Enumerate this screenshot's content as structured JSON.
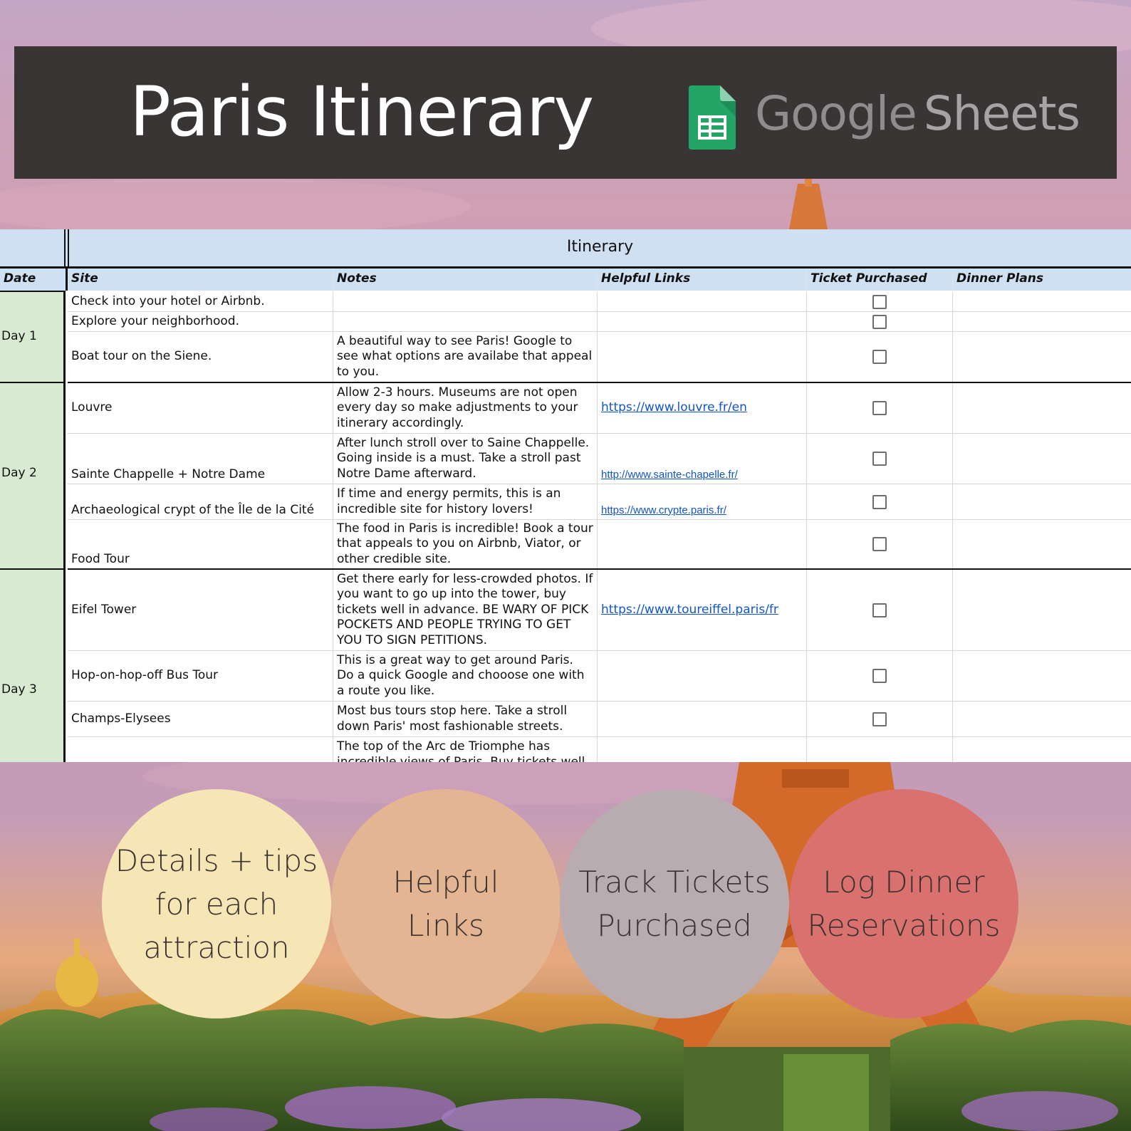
{
  "banner": {
    "title": "Paris Itinerary",
    "brand_word1": "Google",
    "brand_word2": "Sheets"
  },
  "sheet": {
    "section_title": "Itinerary",
    "headers": {
      "date": "Date",
      "site": "Site",
      "notes": "Notes",
      "links": "Helpful Links",
      "ticket": "Ticket Purchased",
      "dinner": "Dinner Plans"
    },
    "days": [
      "Day 1",
      "Day 2",
      "Day 3"
    ],
    "rows": [
      {
        "site": "Check into your hotel or Airbnb.",
        "notes": "",
        "link": "",
        "ticket_purchased": false
      },
      {
        "site": "Explore your neighborhood.",
        "notes": "",
        "link": "",
        "ticket_purchased": false
      },
      {
        "site": "Boat tour on the Siene.",
        "notes": "A beautiful way to see Paris! Google to see what options are availabe that appeal to you.",
        "link": "",
        "ticket_purchased": false
      },
      {
        "site": "Louvre",
        "notes": "Allow 2-3 hours. Museums are not open every day so make adjustments to your itinerary accordingly.",
        "link": "https://www.louvre.fr/en",
        "ticket_purchased": false
      },
      {
        "site": "Sainte Chappelle + Notre Dame",
        "notes": "After lunch stroll over to Saine Chappelle. Going inside is a must. Take a stroll past Notre Dame afterward.",
        "link": "http://www.sainte-chapelle.fr/",
        "ticket_purchased": false
      },
      {
        "site": "Archaeological crypt of the Île de la Cité",
        "notes": "If time and energy permits, this is an incredible site for history lovers!",
        "link": "https://www.crypte.paris.fr/",
        "ticket_purchased": false
      },
      {
        "site": "Food Tour",
        "notes": "The food in Paris is incredible! Book a tour that appeals to you on Airbnb, Viator, or other credible site.",
        "link": "",
        "ticket_purchased": false
      },
      {
        "site": "Eifel Tower",
        "notes": "Get there early for less-crowded photos. If you want to go up into the tower, buy tickets well in advance.  BE WARY OF PICK POCKETS AND PEOPLE TRYING TO GET YOU TO SIGN PETITIONS.",
        "link": "https://www.toureiffel.paris/fr",
        "ticket_purchased": false
      },
      {
        "site": "Hop-on-hop-off Bus Tour",
        "notes": "This is a great way to get around Paris. Do a quick Google and chooose one with a route you like.",
        "link": "",
        "ticket_purchased": false
      },
      {
        "site": "Champs-Elysees",
        "notes": "Most bus tours stop here. Take a stroll down Paris' most fashionable streets.",
        "link": "",
        "ticket_purchased": false
      },
      {
        "site": "",
        "notes": "The top of the Arc de Triomphe has incredible views of Paris. Buy tickets well",
        "link": "",
        "ticket_purchased": false
      }
    ]
  },
  "features": [
    {
      "line1": "Details + tips",
      "line2": "for each",
      "line3": "attraction",
      "color": "#f7e6b5"
    },
    {
      "line1": "Helpful",
      "line2": "Links",
      "color": "#e4b593"
    },
    {
      "line1": "Track Tickets",
      "line2": "Purchased",
      "color": "#b9acb1"
    },
    {
      "line1": "Log Dinner",
      "line2": "Reservations",
      "color": "#d9726e"
    }
  ],
  "colors": {
    "banner_bg": "#393535",
    "header_blue": "#cfe0f2",
    "date_green": "#d9ead3",
    "link_blue": "#1155cc",
    "sheets_green": "#23a566"
  },
  "icons": [
    "google-sheets-icon",
    "checkbox-icon"
  ]
}
